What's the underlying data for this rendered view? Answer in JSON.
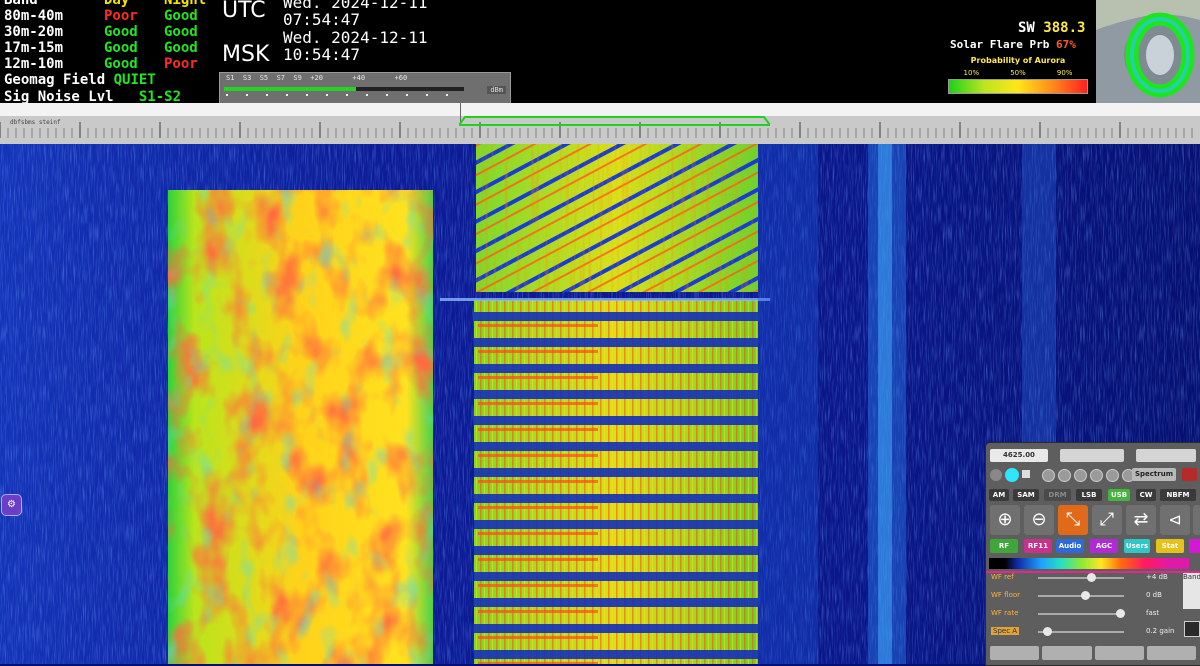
{
  "propagation": {
    "headers": [
      "Band",
      "Day",
      "Night"
    ],
    "rows": [
      {
        "band": "80m-40m",
        "day": "Poor",
        "night": "Good"
      },
      {
        "band": "30m-20m",
        "day": "Good",
        "night": "Good"
      },
      {
        "band": "17m-15m",
        "day": "Good",
        "night": "Good"
      },
      {
        "band": "12m-10m",
        "day": "Good",
        "night": "Poor"
      }
    ],
    "geomag_label": "Geomag Field",
    "geomag_value": "QUIET",
    "signoise_label": "Sig Noise Lvl",
    "signoise_value": "S1-S2"
  },
  "clocks": [
    {
      "label": "UTC",
      "date": "Wed. 2024-12-11",
      "time": "07:54:47"
    },
    {
      "label": "MSK",
      "date": "Wed. 2024-12-11",
      "time": "10:54:47"
    }
  ],
  "smeter": {
    "scale": "S1  S3  S5  S7  S9  +20       +40       +60",
    "level": 0.55,
    "unit": "dBm"
  },
  "solar": {
    "sw_label": "SW",
    "sw_value": "388.3",
    "flare_label": "Solar Flare Prb",
    "flare_value": "67%",
    "aurora_title": "Probability of Aurora",
    "aurora_ticks": [
      "10%",
      "50%",
      "90%"
    ]
  },
  "scale": {
    "dbstep": "dbfsbms  steinf"
  },
  "panel": {
    "freq": "4625.00",
    "band_select": "",
    "spectrum_label": "Spectrum",
    "modes": [
      "AM",
      "SAM",
      "DRM",
      "LSB",
      "USB",
      "CW",
      "NBFM"
    ],
    "active_mode": "USB",
    "functions": [
      "RF",
      "RF11",
      "Audio",
      "AGC",
      "Users",
      "Stat"
    ],
    "sliders": [
      {
        "label": "WF ref",
        "value": "+4 dB",
        "pos": 0.62
      },
      {
        "label": "WF floor",
        "value": "0 dB",
        "pos": 0.55
      },
      {
        "label": "WF rate",
        "value": "fast",
        "pos": 0.95
      },
      {
        "label": "Spec A",
        "value": "0.2 gain",
        "pos": 0.1
      }
    ],
    "side_label": "Band",
    "colors": {
      "accent": "#2ee6ff",
      "mode_active": "#43b53c"
    }
  },
  "side_button_icon": "settings-icon"
}
